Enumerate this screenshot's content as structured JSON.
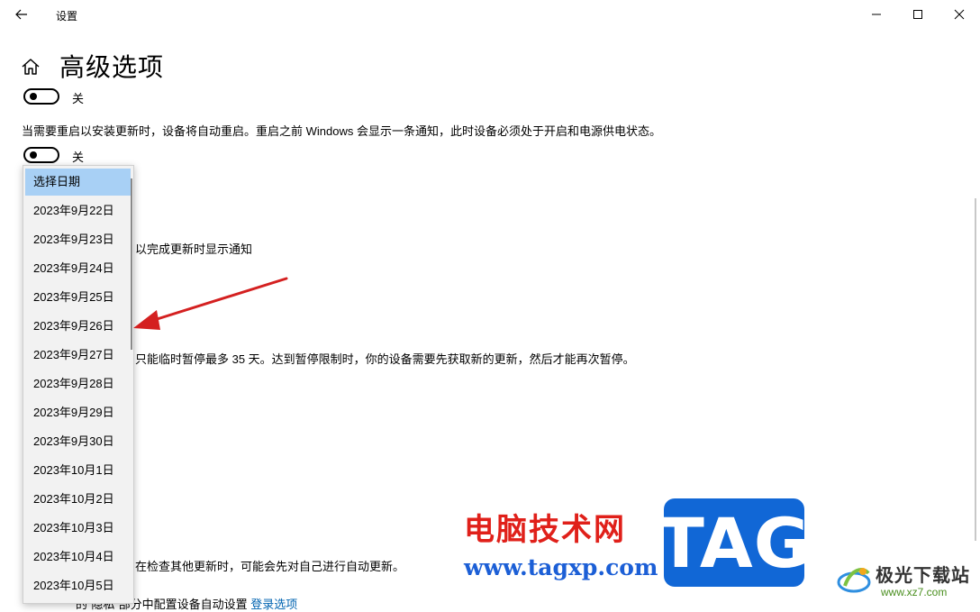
{
  "window": {
    "title": "设置",
    "back_icon": "arrow-left-icon",
    "minimize_icon": "minimize-icon",
    "maximize_icon": "maximize-icon",
    "close_icon": "close-icon"
  },
  "page": {
    "home_icon": "home-icon",
    "title": "高级选项"
  },
  "toggles": [
    {
      "state": "off",
      "label": "关"
    },
    {
      "state": "off",
      "label": "关"
    }
  ],
  "descriptions": {
    "restart_notice": "当需要重启以安装更新时，设备将自动重启。重启之前 Windows 会显示一条通知，此时设备必须处于开启和电源供电状态。",
    "notify_partial": "以完成更新时显示通知",
    "pause_partial": "只能临时暂停最多 35 天。达到暂停限制时，你的设备需要先获取新的更新，然后才能再次暂停。",
    "self_update_partial": "在检查其他更新时，可能会先对自己进行自动更新。",
    "privacy_partial": "的“隐私”部分中配置设备自动设置",
    "privacy_link": "登录选项"
  },
  "date_dropdown": {
    "selected": "选择日期",
    "options": [
      "选择日期",
      "2023年9月22日",
      "2023年9月23日",
      "2023年9月24日",
      "2023年9月25日",
      "2023年9月26日",
      "2023年9月27日",
      "2023年9月28日",
      "2023年9月29日",
      "2023年9月30日",
      "2023年10月1日",
      "2023年10月2日",
      "2023年10月3日",
      "2023年10月4日",
      "2023年10月5日"
    ]
  },
  "watermark": {
    "site_name": "电脑技术网",
    "site_url": "www.tagxp.com",
    "tag_text": "TAG",
    "logo_name": "极光下载站",
    "logo_url": "www.xz7.com"
  },
  "colors": {
    "accent_link": "#0063b1",
    "selected_item": "#a8d0f5",
    "annotation_arrow": "#d42020",
    "watermark_red": "#e0201a",
    "watermark_blue": "#1167d6"
  }
}
